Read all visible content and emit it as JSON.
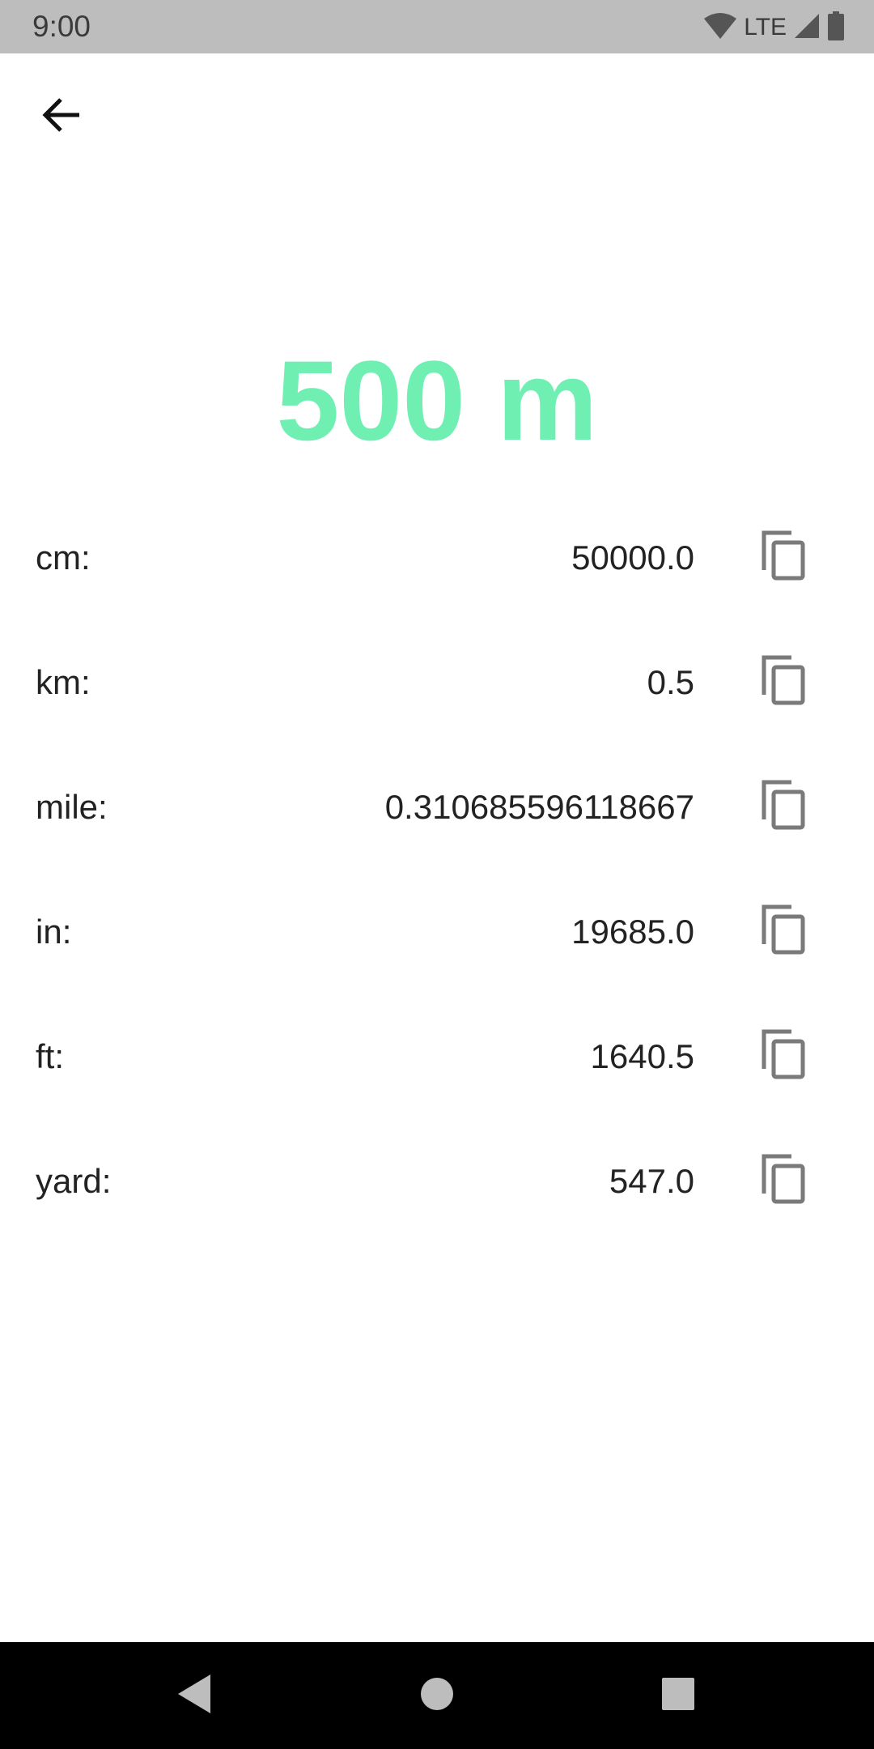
{
  "status_bar": {
    "time": "9:00",
    "network": "LTE",
    "icons": [
      "wifi-icon",
      "cell-signal-icon",
      "battery-icon"
    ]
  },
  "app_bar": {
    "back_icon": "arrow-back-icon"
  },
  "headline": {
    "text": "500 m",
    "color": "#6ff0b2"
  },
  "conversions": [
    {
      "unit_label": "cm:",
      "value": "50000.0",
      "action_icon": "copy-icon"
    },
    {
      "unit_label": "km:",
      "value": "0.5",
      "action_icon": "copy-icon"
    },
    {
      "unit_label": "mile:",
      "value": "0.310685596118667",
      "action_icon": "copy-icon"
    },
    {
      "unit_label": "in:",
      "value": "19685.0",
      "action_icon": "copy-icon"
    },
    {
      "unit_label": "ft:",
      "value": "1640.5",
      "action_icon": "copy-icon"
    },
    {
      "unit_label": "yard:",
      "value": "547.0",
      "action_icon": "copy-icon"
    }
  ],
  "nav_bar": {
    "buttons": [
      "back-triangle-icon",
      "home-circle-icon",
      "recents-square-icon"
    ]
  },
  "colors": {
    "accent": "#6ff0b2",
    "status_bar_bg": "#bdbdbd",
    "nav_bar_bg": "#000000",
    "icon_gray": "#7a7a7a"
  }
}
